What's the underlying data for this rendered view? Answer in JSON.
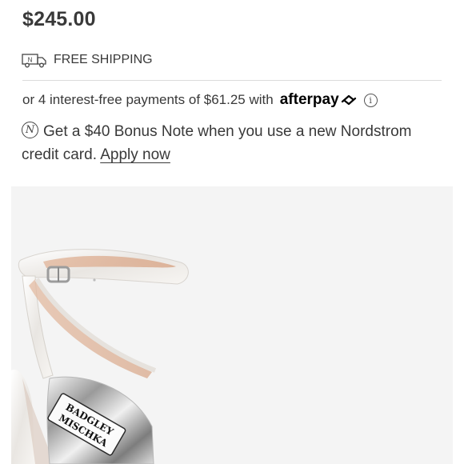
{
  "product": {
    "price": "$245.00",
    "shipping_label": "FREE SHIPPING",
    "shipping_icon_text": "N",
    "brand_on_insole_line1": "BADGLEY",
    "brand_on_insole_line2": "MISCHKA"
  },
  "payments": {
    "text": "or 4 interest-free payments of $61.25 with",
    "provider": "afterpay",
    "info_icon_glyph": "i"
  },
  "bonus": {
    "icon_glyph": "N",
    "text": "Get a $40 Bonus Note when you use a new Nordstrom credit card.",
    "link_label": "Apply now"
  },
  "icons": {
    "truck": "delivery-truck-icon",
    "afterpay": "afterpay-logo-icon",
    "info": "info-icon",
    "note": "nordstrom-note-icon"
  },
  "colors": {
    "text": "#393939",
    "image_bg": "#f4f4f4",
    "divider": "#dcdcdc"
  }
}
